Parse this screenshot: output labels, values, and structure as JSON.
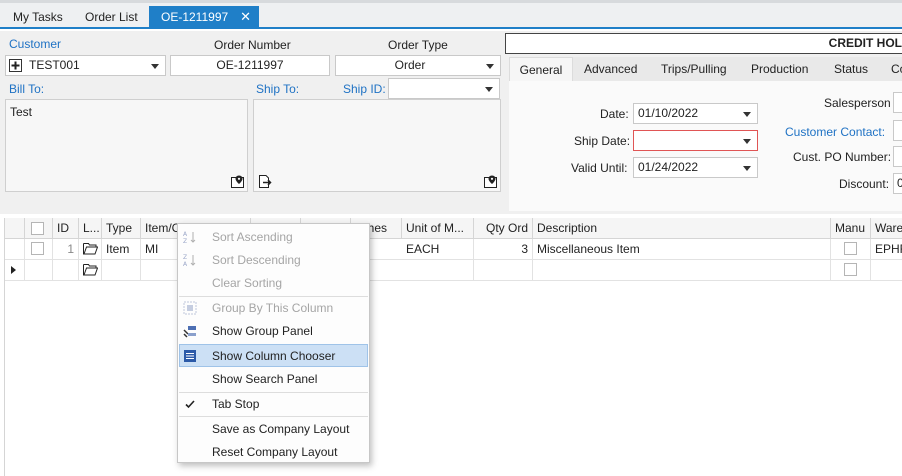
{
  "doc_tabs": [
    {
      "label": "My Tasks"
    },
    {
      "label": "Order List"
    },
    {
      "label": "OE-1211997",
      "close": "✕"
    }
  ],
  "header": {
    "customer_label": "Customer",
    "customer_value": "TEST001",
    "order_number_label": "Order Number",
    "order_number_value": "OE-1211997",
    "order_type_label": "Order Type",
    "order_type_value": "Order",
    "bill_to_label": "Bill To:",
    "bill_to_value": "Test",
    "ship_to_label": "Ship To:",
    "ship_id_label": "Ship ID:",
    "ship_id_value": "",
    "credit_banner": "CREDIT HOL"
  },
  "subtabs": [
    "General",
    "Advanced",
    "Trips/Pulling",
    "Production",
    "Status",
    "Co"
  ],
  "general": {
    "date_label": "Date:",
    "date_value": "01/10/2022",
    "ship_date_label": "Ship Date:",
    "ship_date_value": "",
    "valid_until_label": "Valid Until:",
    "valid_until_value": "01/24/2022",
    "salesperson_label": "Salesperson",
    "customer_contact_label": "Customer Contact:",
    "cust_po_label": "Cust. PO Number:",
    "discount_label": "Discount:",
    "discount_value": "0"
  },
  "grid": {
    "columns": [
      "",
      "ID",
      "L...",
      "Type",
      "Item/C",
      "",
      "",
      "nches",
      "Unit of M...",
      "Qty Ord",
      "Description",
      "Manu",
      "Ware"
    ],
    "rows": [
      {
        "id": "1",
        "type": "Item",
        "item": "MI",
        "unit": "EACH",
        "qty": "3",
        "description": "Miscellaneous Item",
        "warehouse": "EPHR"
      }
    ]
  },
  "context_menu": {
    "items": [
      {
        "label": "Sort Ascending",
        "icon": "sort-ascending-icon",
        "enabled": false
      },
      {
        "label": "Sort Descending",
        "icon": "sort-descending-icon",
        "enabled": false
      },
      {
        "label": "Clear Sorting",
        "icon": "",
        "enabled": false
      },
      {
        "label": "Group By This Column",
        "icon": "group-by-icon",
        "enabled": false
      },
      {
        "label": "Show Group Panel",
        "icon": "group-panel-icon",
        "enabled": true
      },
      {
        "label": "Show Column Chooser",
        "icon": "column-chooser-icon",
        "enabled": true,
        "highlighted": true
      },
      {
        "label": "Show Search Panel",
        "icon": "",
        "enabled": true
      },
      {
        "label": "Tab Stop",
        "icon": "checkmark-icon",
        "enabled": true,
        "checked": true
      },
      {
        "label": "Save as Company Layout",
        "icon": "",
        "enabled": true
      },
      {
        "label": "Reset Company Layout",
        "icon": "",
        "enabled": true
      }
    ]
  },
  "colors": {
    "accent": "#1f7fc8",
    "link": "#1f72c4",
    "highlight": "#cce0f5",
    "error_border": "#e05555"
  }
}
